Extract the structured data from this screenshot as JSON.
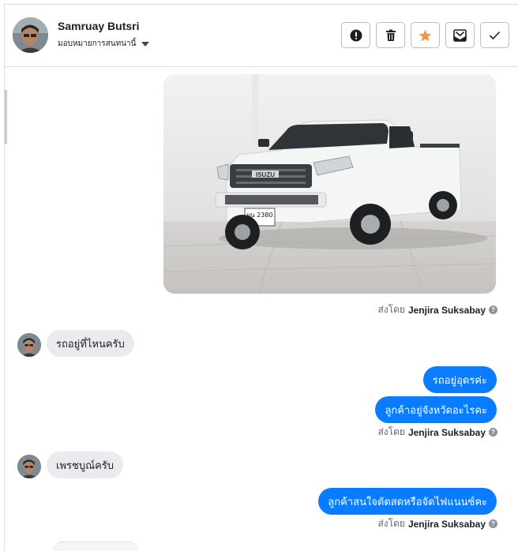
{
  "header": {
    "contact_name": "Samruay Butsri",
    "assign_label": "มอบหมายการสนทนานี้",
    "actions": [
      {
        "name": "spam-icon",
        "color": "#1c1e21"
      },
      {
        "name": "trash-icon",
        "color": "#1c1e21"
      },
      {
        "name": "star-icon",
        "color": "#f7923b"
      },
      {
        "name": "mark-unread-icon",
        "color": "#1c1e21"
      },
      {
        "name": "checkmark-icon",
        "color": "#1c1e21"
      }
    ]
  },
  "conversation": {
    "photo": {
      "plate_text": "ผน 2380",
      "brand_text": "ISUZU"
    },
    "sent_by_prefix": "ส่งโดย",
    "sent_by_name": "Jenjira Suksabay",
    "messages": [
      {
        "direction": "incoming",
        "text": "รถอยู่ที่ไหนครับ"
      },
      {
        "direction": "outgoing",
        "text": "รถอยู่อุดรค่ะ"
      },
      {
        "direction": "outgoing",
        "text": "ลูกค้าอยู่จังหวัดอะไรคะ"
      },
      {
        "direction": "incoming",
        "text": "เพรชบูณ์ครับ"
      },
      {
        "direction": "outgoing",
        "text": "ลูกค้าสนใจตัดสดหรือจัดไฟแนนซ์คะ"
      }
    ]
  },
  "colors": {
    "outgoing_bubble": "#0a7cff",
    "incoming_bubble": "#e9ebee",
    "star": "#f7923b"
  }
}
